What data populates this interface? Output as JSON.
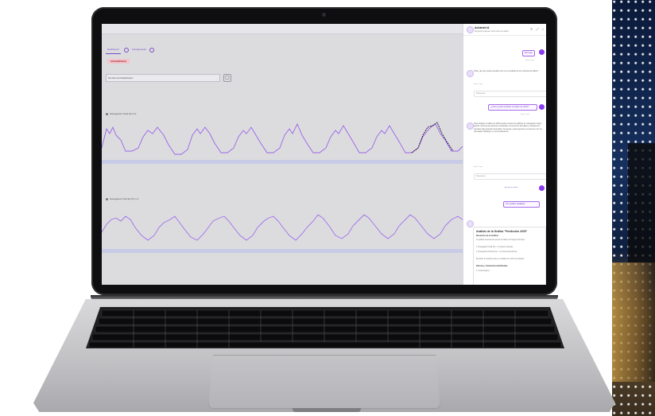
{
  "main": {
    "tabs": [
      "Dashboard",
      "Configuración"
    ],
    "badge": "SUGERENCIA",
    "select_text": "Nombre del Dashboard",
    "chart1_label": "Navegación Total (%) 3.4",
    "chart2_label": "Navegación Parcial (%) 1.2"
  },
  "chat": {
    "title": "Asistente IA",
    "subtitle": "Pregunta cualquier cosa sobre tus datos",
    "msg1_user": "Mensaje",
    "msg1_time": "hace 1 min",
    "msg2_assistant": "Hola! ¿En qué puedo ayudarte hoy con el análisis de tus métricas de tráfico?",
    "msg2_time": "hace 1 min",
    "field1": "Respuesta",
    "msg3_user": "¿Cómo puedo analizar el tráfico de 2024?",
    "msg3_time": "hace 1 min",
    "msg4_assistant": "Para analizar el tráfico de 2024 puedes revisar los gráficos de navegación total y parcial. Observa los patrones semanales, los picos de actividad y compara los periodos para detectar anomalías. Si deseas, puedo generar un resumen con los principales hallazgos y recomendaciones.",
    "msg4_time": "hace 1 min",
    "field2": "Respuesta",
    "msg5_user": "Analiza los datos",
    "msg6_user": "Ver análisis detallado",
    "analysis_title": "Análisis de la Gráfica \"Predicción 2025\"",
    "analysis_sub": "Resumen de la Gráfica",
    "analysis_lines": [
      "La gráfica muestra dos series de datos a lo largo del tiempo:",
      "1. Navegación Total (%) - 3.4 (línea continua)",
      "2. Navegación Parcial (%) - 1.2 (línea discontinua)",
      "El patrón de ambas series es estable con ciclos semanales.",
      "Patrones y Tendencias Identificadas",
      "1. Ciclos Diarios"
    ]
  }
}
